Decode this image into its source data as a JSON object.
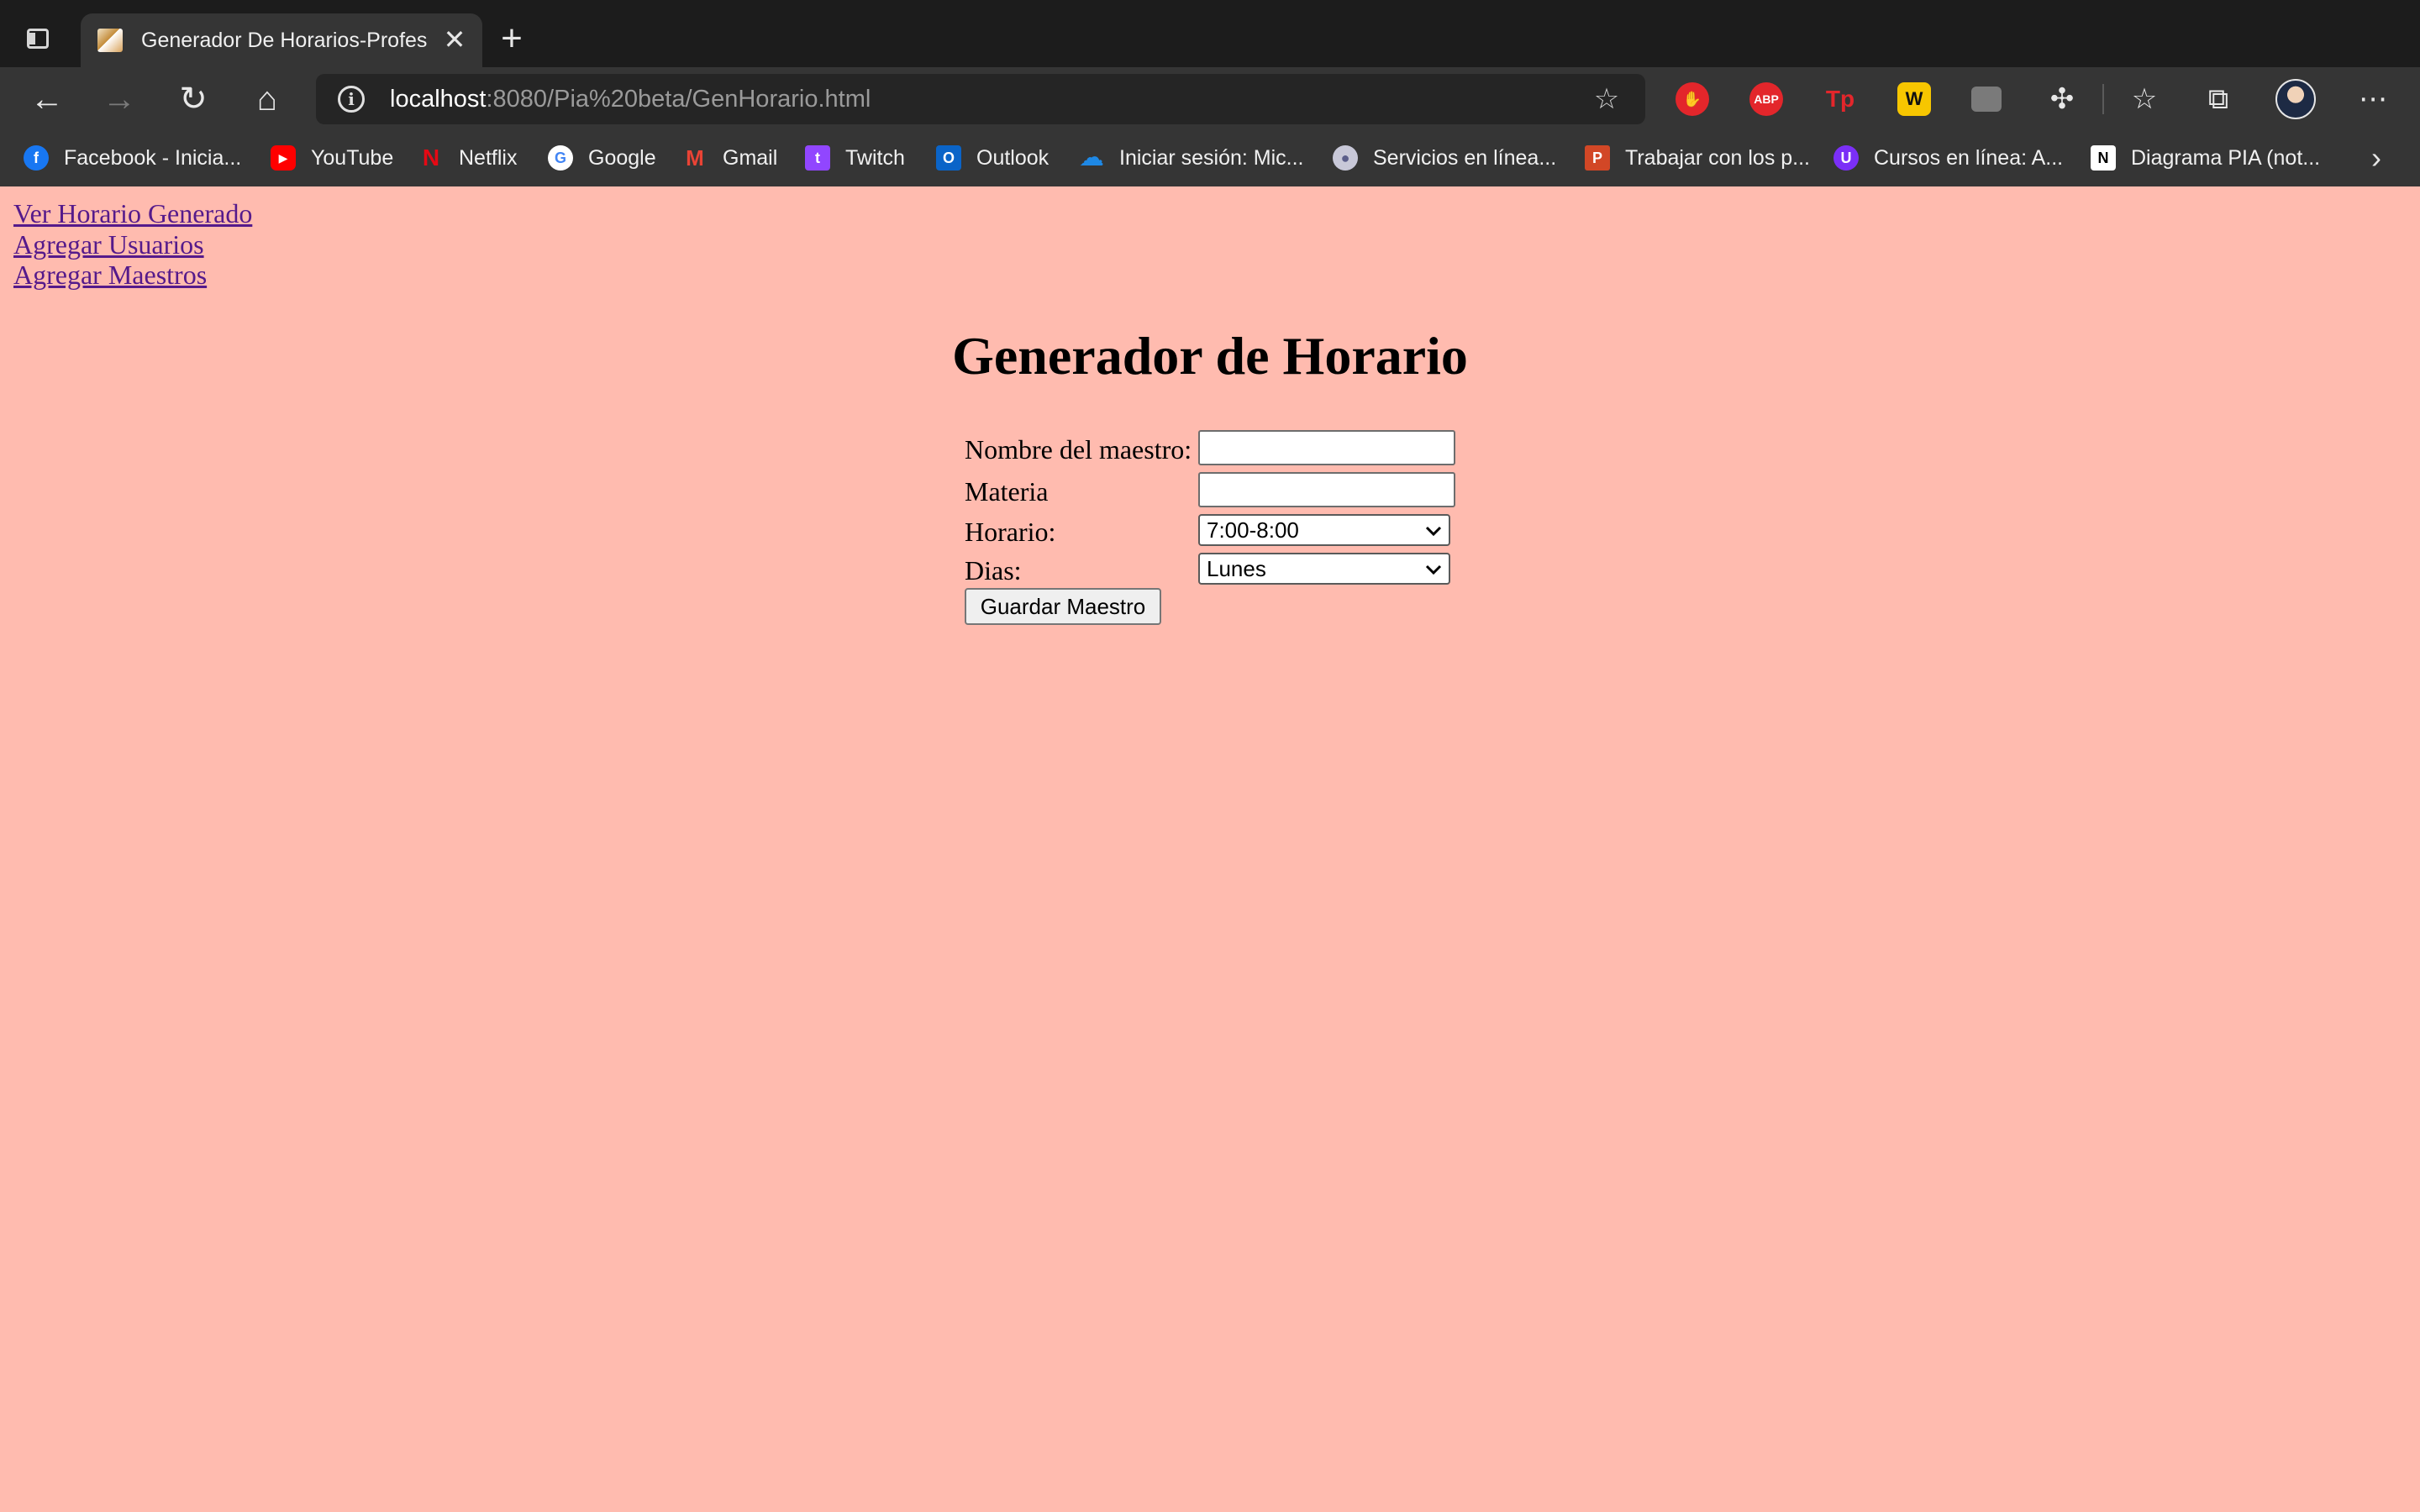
{
  "tabs": [
    {
      "title": "Generador De Horarios-Profes",
      "active": true
    }
  ],
  "toolbar": {
    "url_host": "localhost",
    "url_rest": ":8080/Pia%20beta/GenHorario.html"
  },
  "extensions": [
    {
      "name": "stop-hand-icon",
      "label": "",
      "color": "#e3262b"
    },
    {
      "name": "adblock-plus-icon",
      "label": "ABP",
      "color": "#e3262b"
    },
    {
      "name": "tp-icon",
      "label": "Tp",
      "color": "#e3262b"
    },
    {
      "name": "w-icon",
      "label": "W",
      "color": "#1a1a1a"
    },
    {
      "name": "picture-in-picture-icon",
      "label": "",
      "color": "#8a8a8a"
    }
  ],
  "bookmarks": [
    {
      "label": "Facebook - Inicia...",
      "icon": "facebook-icon",
      "color": "#1877f2",
      "glyph": "f"
    },
    {
      "label": "YouTube",
      "icon": "youtube-icon",
      "color": "#ff0000",
      "glyph": "▶"
    },
    {
      "label": "Netflix",
      "icon": "netflix-icon",
      "color": "#e50914",
      "glyph": "N"
    },
    {
      "label": "Google",
      "icon": "google-icon",
      "color": "#ffffff",
      "glyph": "G"
    },
    {
      "label": "Gmail",
      "icon": "gmail-icon",
      "color": "#ea4335",
      "glyph": "M"
    },
    {
      "label": "Twitch",
      "icon": "twitch-icon",
      "color": "#9146ff",
      "glyph": "t"
    },
    {
      "label": "Outlook",
      "icon": "outlook-icon",
      "color": "#0a64c8",
      "glyph": "O"
    },
    {
      "label": "Iniciar sesión: Mic...",
      "icon": "onedrive-icon",
      "color": "#1e88e5",
      "glyph": "☁"
    },
    {
      "label": "Servicios en línea...",
      "icon": "university-seal-icon",
      "color": "#5b5e8a",
      "glyph": "●"
    },
    {
      "label": "Trabajar con los p...",
      "icon": "powerpoint-icon",
      "color": "#d24726",
      "glyph": "P"
    },
    {
      "label": "Cursos en línea: A...",
      "icon": "course-icon",
      "color": "#7b2ff7",
      "glyph": "U"
    },
    {
      "label": "Diagrama PIA (not...",
      "icon": "notion-icon",
      "color": "#ffffff",
      "glyph": "N"
    }
  ],
  "page": {
    "nav_links": [
      "Ver Horario Generado",
      "Agregar Usuarios",
      "Agregar Maestros"
    ],
    "heading": "Generador de Horario",
    "form": {
      "teacher_label": "Nombre del maestro:",
      "teacher_value": "",
      "subject_label": "Materia",
      "subject_value": "",
      "schedule_label": "Horario:",
      "schedule_value": "7:00-8:00",
      "days_label": "Dias:",
      "days_value": "Lunes",
      "submit_label": "Guardar Maestro"
    }
  },
  "colors": {
    "page_background": "#ffbbaf",
    "link": "#551a8b",
    "browser_chrome": "#353535"
  }
}
